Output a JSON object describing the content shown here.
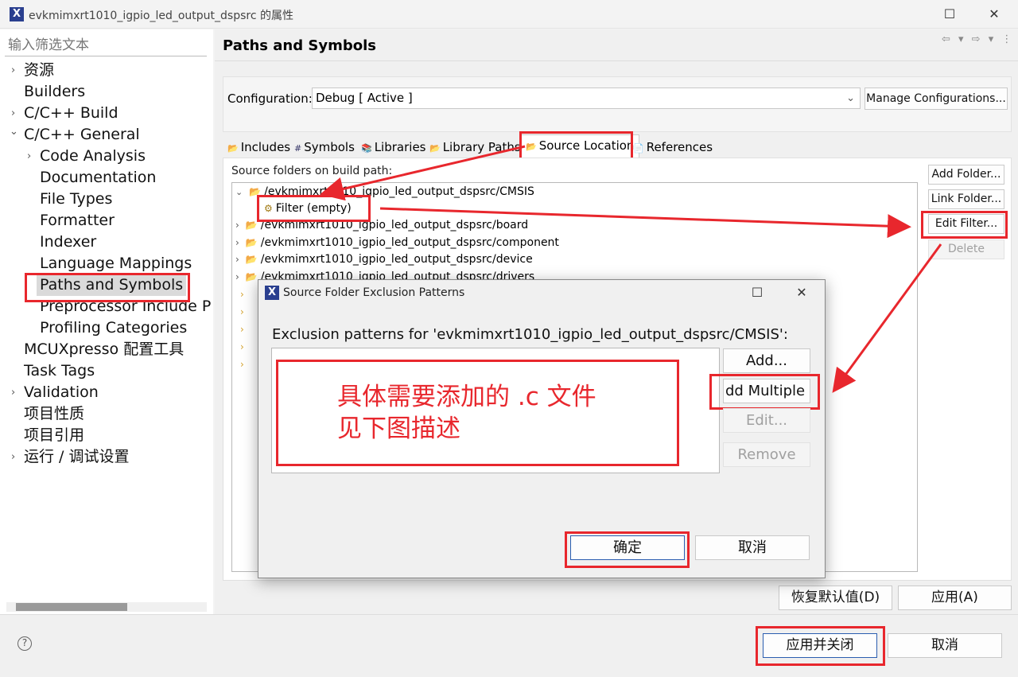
{
  "window": {
    "title": "evkmimxrt1010_igpio_led_output_dspsrc 的属性",
    "icon_letter": "X",
    "maximize_glyph": "☐",
    "close_glyph": "✕"
  },
  "left": {
    "filter_placeholder": "输入筛选文本",
    "tree": [
      {
        "label": "资源",
        "expander": "›"
      },
      {
        "label": "Builders",
        "expander": ""
      },
      {
        "label": "C/C++ Build",
        "expander": "›"
      },
      {
        "label": "C/C++ General",
        "expander": "⌄"
      },
      {
        "label": "Code Analysis",
        "expander": "›"
      },
      {
        "label": "Documentation",
        "expander": ""
      },
      {
        "label": "File Types",
        "expander": ""
      },
      {
        "label": "Formatter",
        "expander": ""
      },
      {
        "label": "Indexer",
        "expander": ""
      },
      {
        "label": "Language Mappings",
        "expander": ""
      },
      {
        "label": "Paths and Symbols",
        "expander": ""
      },
      {
        "label": "Preprocessor Include P",
        "expander": ""
      },
      {
        "label": "Profiling Categories",
        "expander": ""
      },
      {
        "label": "MCUXpresso 配置工具",
        "expander": ""
      },
      {
        "label": "Task Tags",
        "expander": ""
      },
      {
        "label": "Validation",
        "expander": "›"
      },
      {
        "label": "项目性质",
        "expander": ""
      },
      {
        "label": "项目引用",
        "expander": ""
      },
      {
        "label": "运行 / 调试设置",
        "expander": "›"
      }
    ]
  },
  "main": {
    "title": "Paths and Symbols",
    "nav_arrows": "⇦ ▾ ⇨ ▾ ⋮",
    "config_label": "Configuration:",
    "config_value": "Debug  [ Active ]",
    "config_chevron": "⌄",
    "manage_button": "Manage Configurations...",
    "tabs": [
      {
        "label": "Includes",
        "icon": "📂"
      },
      {
        "label": "Symbols",
        "icon": "#"
      },
      {
        "label": "Libraries",
        "icon": "📚"
      },
      {
        "label": "Library Paths",
        "icon": "📂"
      },
      {
        "label": "Source Location",
        "icon": "📂"
      },
      {
        "label": "References",
        "icon": "📄"
      }
    ],
    "source_label": "Source folders on build path:",
    "source_tree": [
      {
        "label": "/evkmimxrt1010_igpio_led_output_dspsrc/CMSIS",
        "expander": "⌄"
      },
      {
        "label": "Filter (empty)",
        "expander": ""
      },
      {
        "label": "/evkmimxrt1010_igpio_led_output_dspsrc/board",
        "expander": "›"
      },
      {
        "label": "/evkmimxrt1010_igpio_led_output_dspsrc/component",
        "expander": "›"
      },
      {
        "label": "/evkmimxrt1010_igpio_led_output_dspsrc/device",
        "expander": "›"
      },
      {
        "label": "/evkmimxrt1010_igpio_led_output_dspsrc/drivers",
        "expander": "›"
      }
    ],
    "side_buttons": {
      "add_folder": "Add Folder...",
      "link_folder": "Link Folder...",
      "edit_filter": "Edit Filter...",
      "delete": "Delete"
    },
    "restore_button": "恢复默认值(D)",
    "apply_button": "应用(A)"
  },
  "dialog": {
    "title": "Source Folder Exclusion Patterns",
    "label": "Exclusion patterns for 'evkmimxrt1010_igpio_led_output_dspsrc/CMSIS':",
    "add": "Add...",
    "add_multiple": "dd Multiple",
    "edit": "Edit...",
    "remove": "Remove",
    "ok": "确定",
    "cancel": "取消",
    "annotation_line1": "具体需要添加的 .c 文件",
    "annotation_line2": "见下图描述"
  },
  "footer": {
    "help": "?",
    "apply_close": "应用并关闭",
    "cancel": "取消"
  },
  "colors": {
    "annotation_red": "#e8272d",
    "app_icon": "#2a3f8f"
  }
}
